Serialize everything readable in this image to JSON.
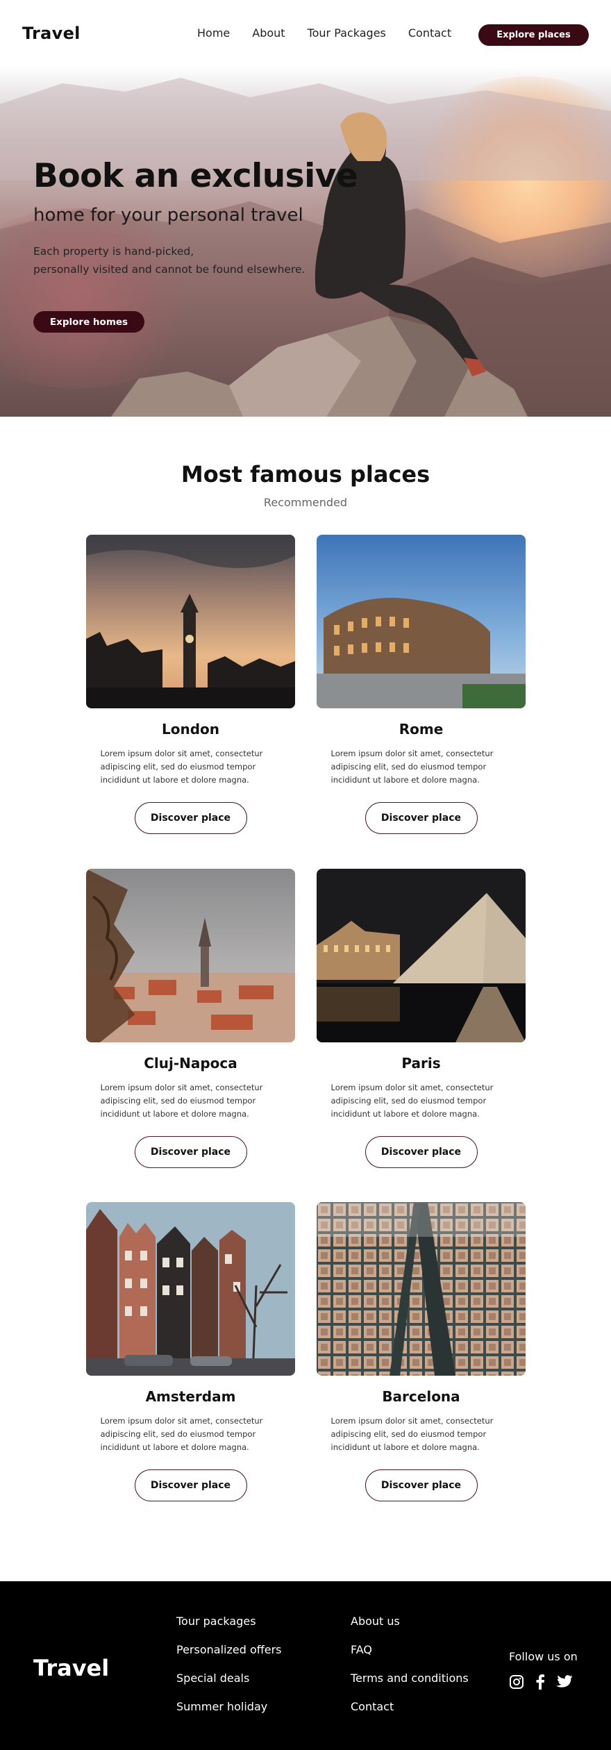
{
  "nav": {
    "brand": "Travel",
    "links": [
      "Home",
      "About",
      "Tour Packages",
      "Contact"
    ],
    "cta": "Explore places"
  },
  "hero": {
    "title": "Book an exclusive",
    "subtitle": "home for your personal travel",
    "description_line1": "Each property is hand-picked,",
    "description_line2": "personally visited and cannot be found elsewhere.",
    "cta": "Explore homes"
  },
  "places": {
    "title": "Most famous places",
    "subtitle": "Recommended",
    "cards": [
      {
        "name": "London",
        "description": "Lorem ipsum dolor sit amet, consectetur adipiscing elit, sed do eiusmod tempor incididunt ut labore et dolore magna.",
        "button": "Discover place"
      },
      {
        "name": "Rome",
        "description": "Lorem ipsum dolor sit amet, consectetur adipiscing elit, sed do eiusmod tempor incididunt ut labore et dolore magna.",
        "button": "Discover place"
      },
      {
        "name": "Cluj-Napoca",
        "description": "Lorem ipsum dolor sit amet, consectetur adipiscing elit, sed do eiusmod tempor incididunt ut labore et dolore magna.",
        "button": "Discover place"
      },
      {
        "name": "Paris",
        "description": "Lorem ipsum dolor sit amet, consectetur adipiscing elit, sed do eiusmod tempor incididunt ut labore et dolore magna.",
        "button": "Discover place"
      },
      {
        "name": "Amsterdam",
        "description": "Lorem ipsum dolor sit amet, consectetur adipiscing elit, sed do eiusmod tempor incididunt ut labore et dolore magna.",
        "button": "Discover place"
      },
      {
        "name": "Barcelona",
        "description": "Lorem ipsum dolor sit amet, consectetur adipiscing elit, sed do eiusmod tempor incididunt ut labore et dolore magna.",
        "button": "Discover place"
      }
    ]
  },
  "footer": {
    "brand": "Travel",
    "col1": [
      "Tour packages",
      "Personalized offers",
      "Special deals",
      "Summer holiday"
    ],
    "col2": [
      "About us",
      "FAQ",
      "Terms and conditions",
      "Contact"
    ],
    "follow": "Follow us on",
    "social_icons": [
      "instagram-icon",
      "facebook-icon",
      "twitter-icon"
    ]
  },
  "colors": {
    "accent": "#3a0a14",
    "footer_bg": "#000000"
  }
}
